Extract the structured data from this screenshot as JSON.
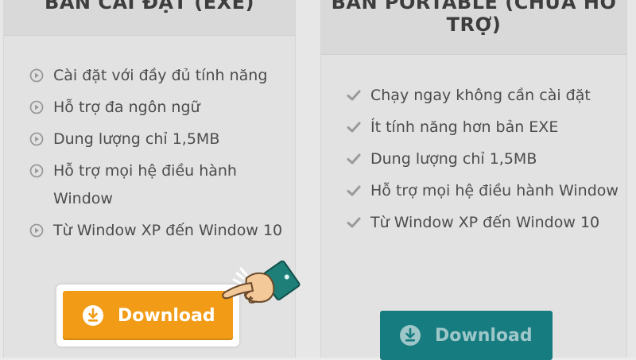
{
  "left_panel": {
    "title": "BẢN CÀI ĐẶT (EXE)",
    "features": [
      "Cài đặt với đầy đủ tính năng",
      "Hỗ trợ đa ngôn ngữ",
      "Dung lượng chỉ 1,5MB",
      "Hỗ trợ mọi hệ điều hành Window",
      "Từ Window XP đến Window 10"
    ],
    "feature_icon": "play-circle-icon",
    "download_label": "Download",
    "download_color": "#f29b17"
  },
  "right_panel": {
    "title": "BẢN PORTABLE (CHƯA HỖ TRỢ)",
    "features": [
      "Chạy ngay không cần cài đặt",
      "Ít tính năng hơn bản EXE",
      "Dung lượng chỉ 1,5MB",
      "Hỗ trợ mọi hệ điều hành Window",
      "Từ Window XP đến Window 10"
    ],
    "feature_icon": "check-icon",
    "download_label": "Download",
    "download_color": "#177c80"
  },
  "pointer_icon": "pointing-hand-icon"
}
